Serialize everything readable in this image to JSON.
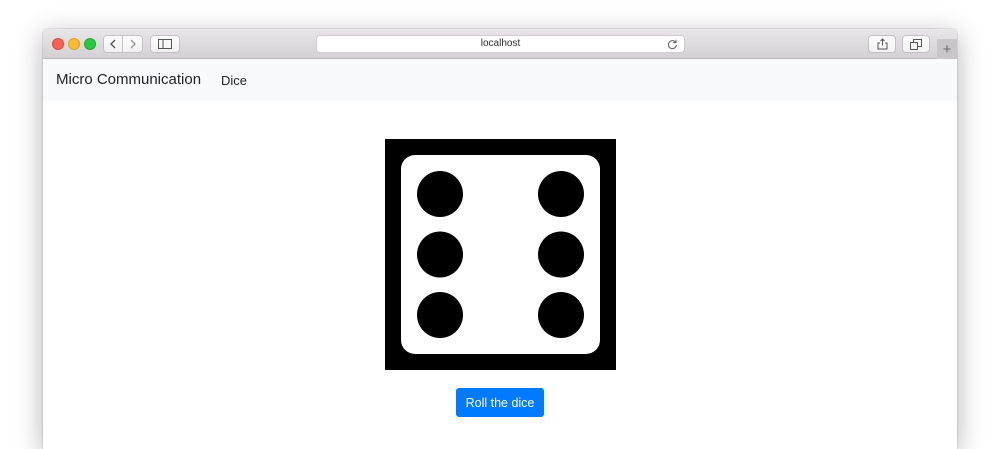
{
  "browser": {
    "address": "localhost",
    "icons": {
      "back": "chevron-left-icon",
      "forward": "chevron-right-icon",
      "sidebar": "sidebar-icon",
      "reload": "reload-icon",
      "share": "share-icon",
      "tabs": "tabs-overview-icon",
      "new_tab": "plus-icon"
    },
    "new_tab_symbol": "+"
  },
  "navbar": {
    "brand": "Micro Communication",
    "links": [
      "Dice"
    ]
  },
  "main": {
    "dice_value": 6,
    "roll_button_label": "Roll the dice"
  },
  "colors": {
    "primary": "#007bff",
    "navbar_bg": "#f8f9fa",
    "dice_frame": "#000000",
    "dice_face": "#ffffff",
    "pip": "#000000"
  }
}
